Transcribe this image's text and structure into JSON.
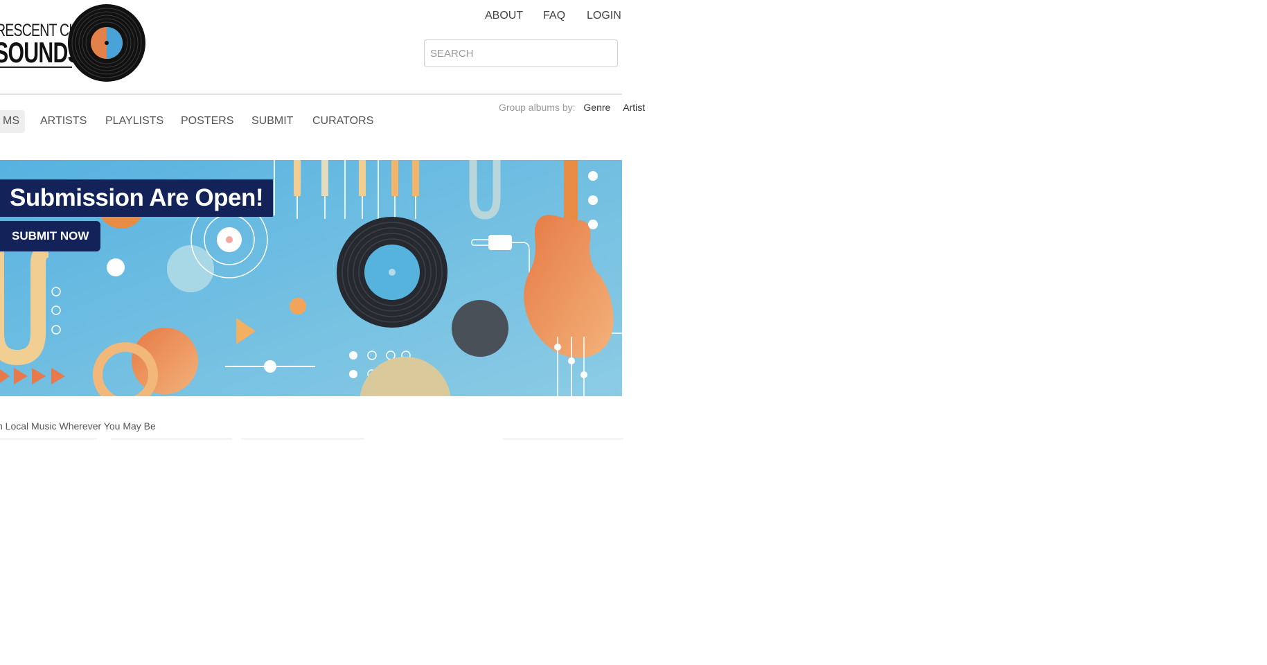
{
  "logo": {
    "line1": "RESCENT CITY",
    "line2": "SOUNDS",
    "colors": {
      "record": "#111111",
      "label_blue": "#4aa3d8",
      "label_orange": "#e2824a"
    }
  },
  "top_links": [
    "ABOUT",
    "FAQ",
    "LOGIN"
  ],
  "search": {
    "placeholder": "SEARCH",
    "value": ""
  },
  "group_by": {
    "label": "Group albums by:",
    "options": [
      "Genre",
      "Artist"
    ]
  },
  "nav": {
    "active": "MS",
    "items": [
      "ARTISTS",
      "PLAYLISTS",
      "POSTERS",
      "SUBMIT",
      "CURATORS"
    ]
  },
  "banner": {
    "title": "Submission Are Open!",
    "button": "SUBMIT NOW",
    "colors": {
      "background": "#5db7df",
      "navy": "#13235a",
      "orange": "#e88b45",
      "cream": "#f4d9a6",
      "dark": "#2b2f35"
    }
  },
  "tagline": "h Local Music Wherever You May Be"
}
